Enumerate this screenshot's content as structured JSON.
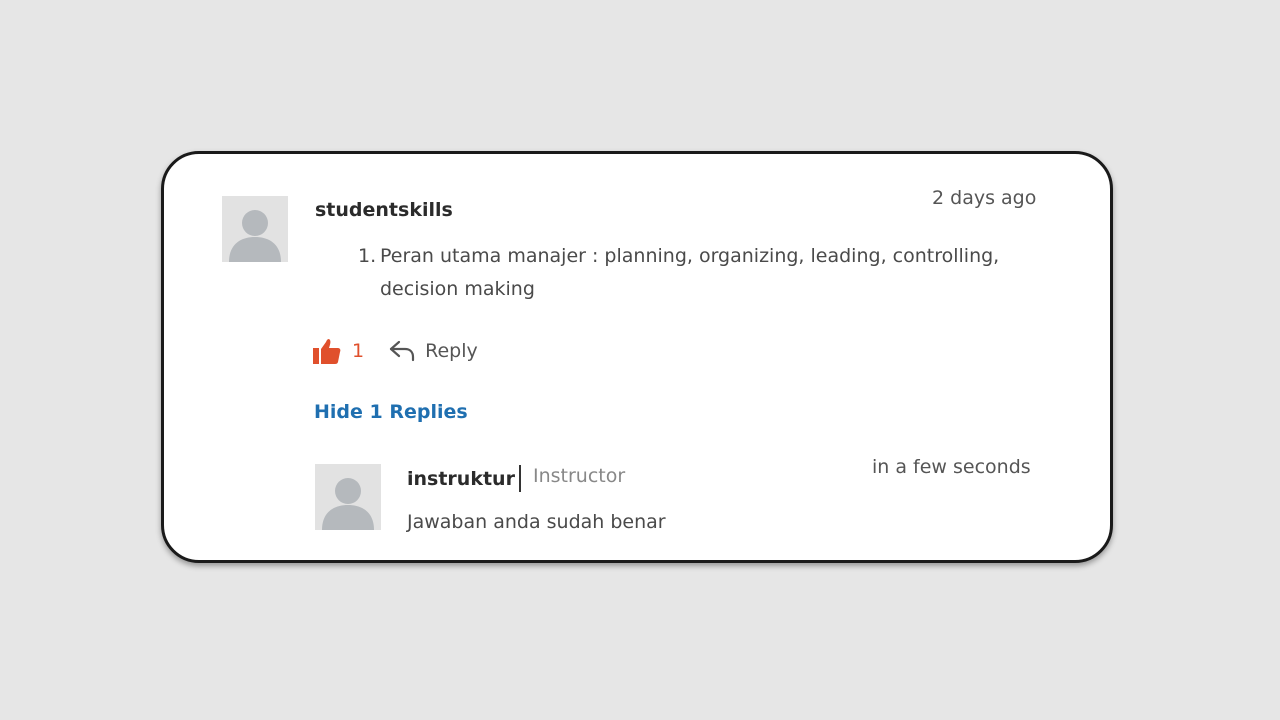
{
  "comment": {
    "author": "studentskills",
    "timestamp": "2 days ago",
    "list_items": [
      {
        "number": "1.",
        "text": "Peran utama manajer : planning, organizing, leading, controlling, decision making"
      }
    ],
    "like_count": "1",
    "reply_label": "Reply",
    "toggle_replies_label": "Hide 1 Replies"
  },
  "reply": {
    "author": "instruktur",
    "role": "Instructor",
    "timestamp": "in a few seconds",
    "text": "Jawaban anda sudah benar"
  },
  "icons": {
    "like": "thumbs-up-icon",
    "reply": "reply-arrow-icon",
    "avatar": "user-silhouette-icon"
  },
  "colors": {
    "like_accent": "#e0502c",
    "link": "#1f6fb0",
    "avatar_bg": "#e2e2e2",
    "avatar_figure": "#b5b9bd"
  }
}
